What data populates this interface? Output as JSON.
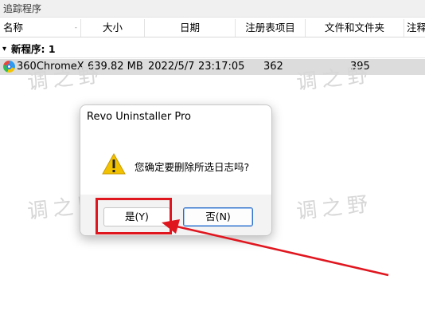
{
  "window": {
    "title": "追踪程序"
  },
  "columns": [
    "名称",
    "大小",
    "日期",
    "注册表项目",
    "文件和文件夹",
    "注释"
  ],
  "group": {
    "label": "新程序: 1"
  },
  "row": {
    "name": "360ChromeX",
    "size": "639.82 MB",
    "date": "2022/5/7",
    "time": "23:17:05",
    "registry": "362",
    "files": "395"
  },
  "watermark": "调之野",
  "dialog": {
    "title": "Revo Uninstaller Pro",
    "message": "您确定要删除所选日志吗?",
    "yes_label": "是(Y)",
    "no_label": "否(N)"
  },
  "colors": {
    "annotation": "#e0161f",
    "warning": "#f2c200",
    "selection_row": "#dcdcdc"
  },
  "icons": {
    "app": "360chrome-icon",
    "warning": "warning-icon",
    "sort": "sort-arrow-icon"
  }
}
